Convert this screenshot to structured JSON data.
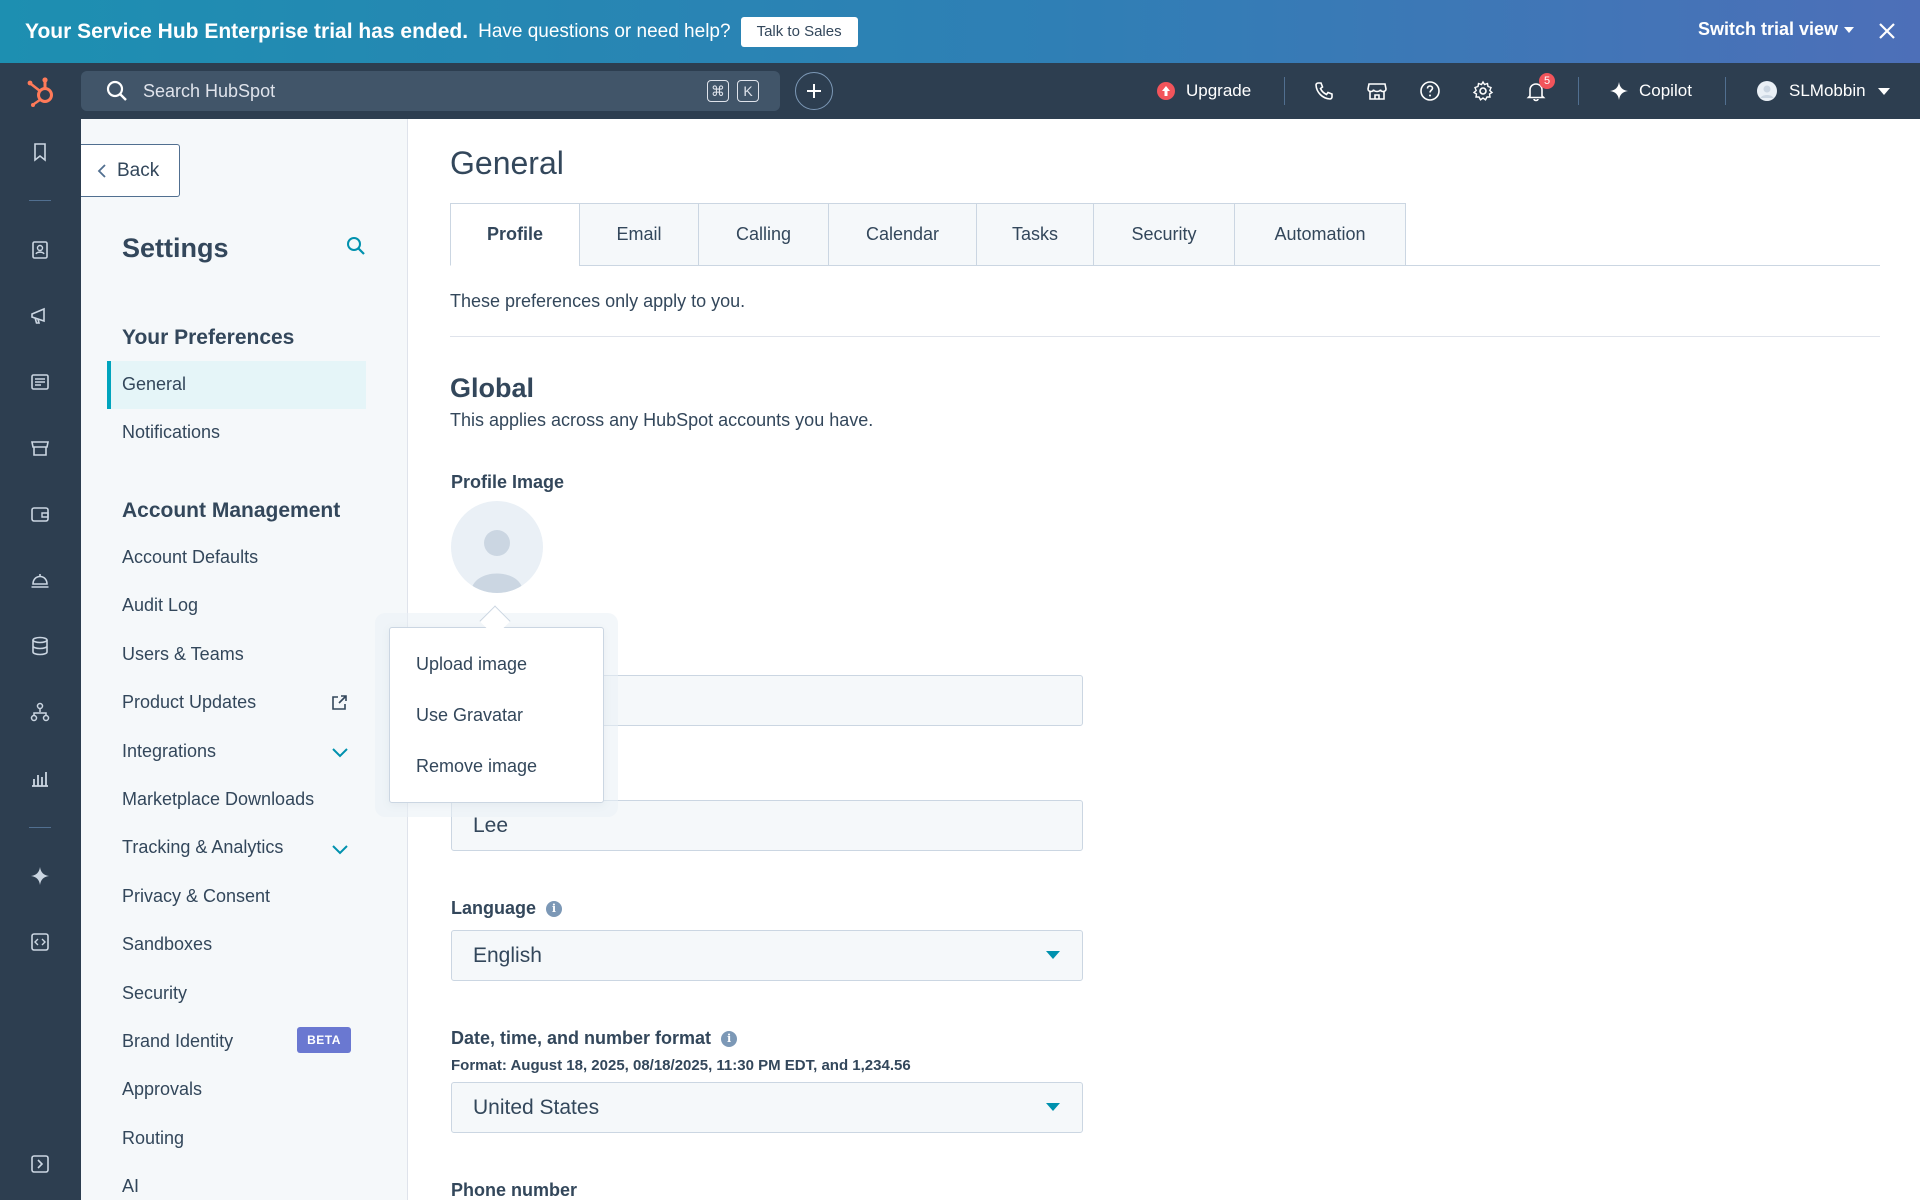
{
  "banner": {
    "title": "Your Service Hub Enterprise trial has ended.",
    "subtitle": "Have questions or need help?",
    "talk_to_sales": "Talk to Sales",
    "switch_view": "Switch trial view"
  },
  "topnav": {
    "search_placeholder": "Search HubSpot",
    "kbd_cmd": "⌘",
    "kbd_k": "K",
    "upgrade": "Upgrade",
    "notifications_count": "5",
    "copilot": "Copilot",
    "user": "SLMobbin"
  },
  "sidebar": {
    "back": "Back",
    "title": "Settings",
    "sections": [
      {
        "heading": "Your Preferences",
        "items": [
          "General",
          "Notifications"
        ]
      },
      {
        "heading": "Account Management",
        "items": [
          "Account Defaults",
          "Audit Log",
          "Users & Teams",
          "Product Updates",
          "Integrations",
          "Marketplace Downloads",
          "Tracking & Analytics",
          "Privacy & Consent",
          "Sandboxes",
          "Security",
          "Brand Identity",
          "Approvals",
          "Routing",
          "AI"
        ]
      }
    ],
    "beta": "BETA"
  },
  "main": {
    "title": "General",
    "tabs": [
      "Profile",
      "Email",
      "Calling",
      "Calendar",
      "Tasks",
      "Security",
      "Automation"
    ],
    "pref_note": "These preferences only apply to you.",
    "global_title": "Global",
    "global_sub": "This applies across any HubSpot accounts you have.",
    "profile_image_label": "Profile Image",
    "first_name_value": "",
    "last_name_value": "Lee",
    "language_label": "Language",
    "language_value": "English",
    "format_label": "Date, time, and number format",
    "format_note": "Format: August 18, 2025, 08/18/2025, 11:30 PM EDT, and 1,234.56",
    "format_value": "United States",
    "phone_label": "Phone number"
  },
  "popover": {
    "items": [
      "Upload image",
      "Use Gravatar",
      "Remove image"
    ]
  },
  "colors": {
    "brand_orange": "#ff7a59",
    "teal": "#00a4bd",
    "nav_bg": "#2d3e50",
    "beta_bg": "#6a78d1"
  }
}
